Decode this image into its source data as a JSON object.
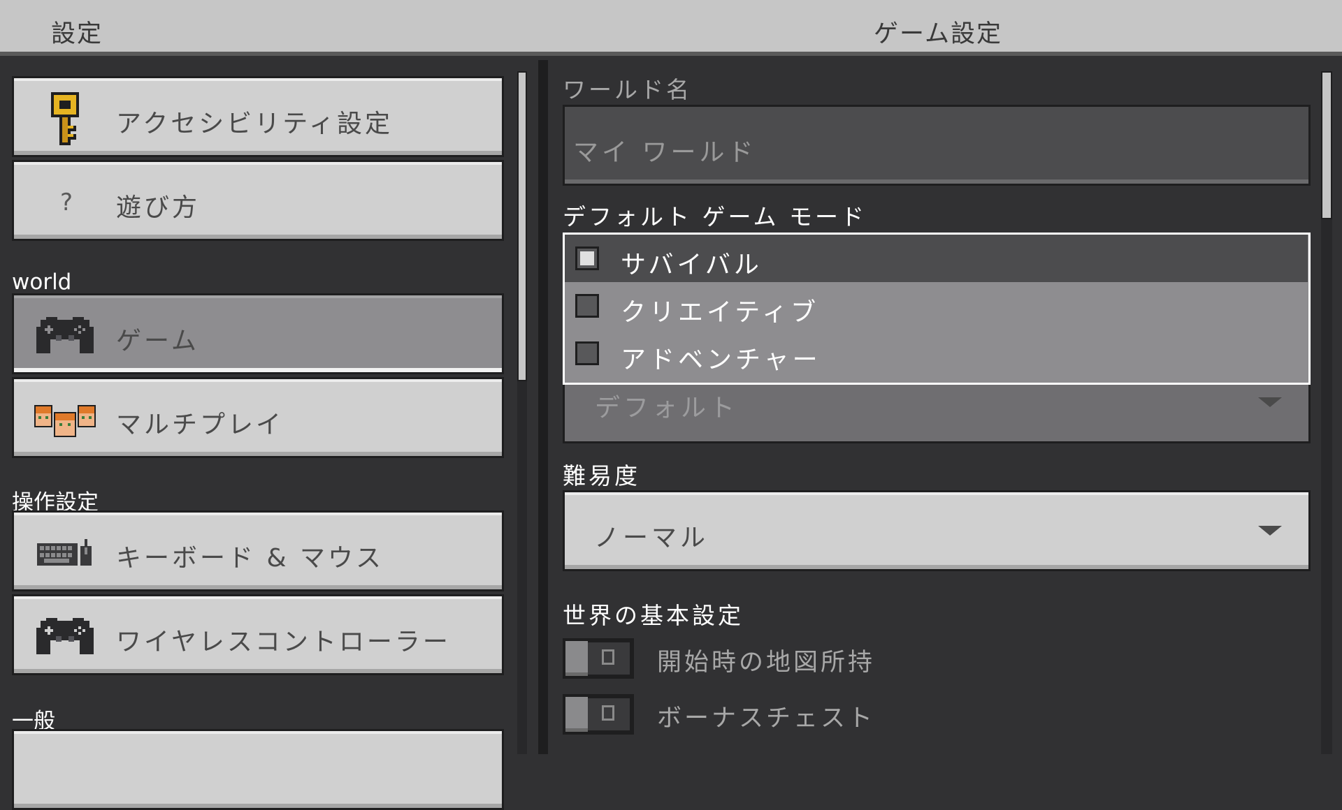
{
  "header": {
    "left_title": "設定",
    "right_title": "ゲーム設定"
  },
  "sidebar": {
    "items_top": [
      {
        "label": "アクセシビリティ設定",
        "icon": "key-icon"
      },
      {
        "label": "遊び方",
        "icon": "question-icon",
        "glyph": "?"
      }
    ],
    "section_world": "world",
    "items_world": [
      {
        "label": "ゲーム",
        "icon": "gamepad-icon",
        "selected": true
      },
      {
        "label": "マルチプレイ",
        "icon": "players-icon"
      }
    ],
    "section_controls": "操作設定",
    "items_controls": [
      {
        "label": "キーボード & マウス",
        "icon": "keyboard-mouse-icon"
      },
      {
        "label": "ワイヤレスコントローラー",
        "icon": "controller-icon"
      }
    ],
    "section_general": "一般"
  },
  "main": {
    "world_name": {
      "label": "ワールド名",
      "value": "マイ ワールド"
    },
    "game_mode": {
      "label": "デフォルト ゲーム モード",
      "options": [
        {
          "label": "サバイバル",
          "checked": true
        },
        {
          "label": "クリエイティブ",
          "checked": false
        },
        {
          "label": "アドベンチャー",
          "checked": false
        }
      ],
      "underlying_value": "デフォルト"
    },
    "difficulty": {
      "label": "難易度",
      "value": "ノーマル"
    },
    "world_prefs": {
      "label": "世界の基本設定",
      "toggles": [
        {
          "label": "開始時の地図所持",
          "on": false
        },
        {
          "label": "ボーナスチェスト",
          "on": false
        }
      ]
    }
  },
  "colors": {
    "background": "#313133",
    "button": "#d0d0d0",
    "selected_button": "#8e8d90",
    "header": "#c6c6c6"
  }
}
